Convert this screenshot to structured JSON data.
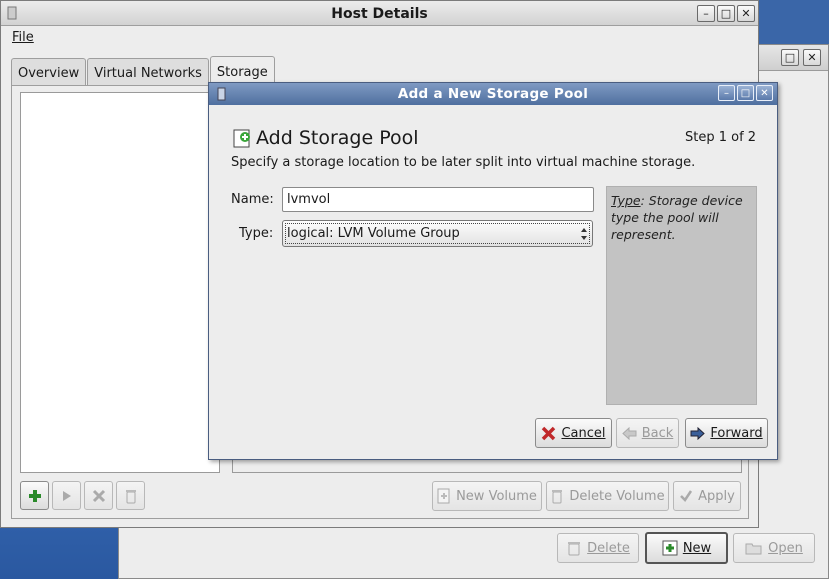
{
  "host_window": {
    "title": "Host Details",
    "menu_file": "File",
    "tabs": [
      {
        "label": "Overview"
      },
      {
        "label": "Virtual Networks"
      },
      {
        "label": "Storage"
      }
    ],
    "buttons": {
      "new_volume": "New Volume",
      "delete_volume": "Delete Volume",
      "apply": "Apply"
    }
  },
  "background_window": {
    "buttons": {
      "delete": "Delete",
      "new": "New",
      "open": "Open"
    }
  },
  "dialog": {
    "title": "Add a New Storage Pool",
    "heading": "Add Storage Pool",
    "step": "Step 1 of 2",
    "description": "Specify a storage location to be later split into virtual machine storage.",
    "name_label": "Name:",
    "name_value": "lvmvol",
    "type_label": "Type:",
    "type_value": "logical: LVM Volume Group",
    "help_term": "Type",
    "help_text": ": Storage device type the pool will represent.",
    "buttons": {
      "cancel": "Cancel",
      "back": "Back",
      "forward": "Forward"
    }
  },
  "colors": {
    "dialog_title_bg": "#5b7aaa",
    "help_panel_bg": "#c3c3c3",
    "desktop_bg": "#3a66a8"
  },
  "icons": [
    "app-icon",
    "minimize-icon",
    "maximize-icon",
    "close-icon",
    "add-icon",
    "play-icon",
    "stop-icon",
    "trash-icon",
    "arrow-left-icon",
    "arrow-right-icon",
    "combo-arrows-icon",
    "folder-open-icon",
    "checkmark-icon"
  ]
}
